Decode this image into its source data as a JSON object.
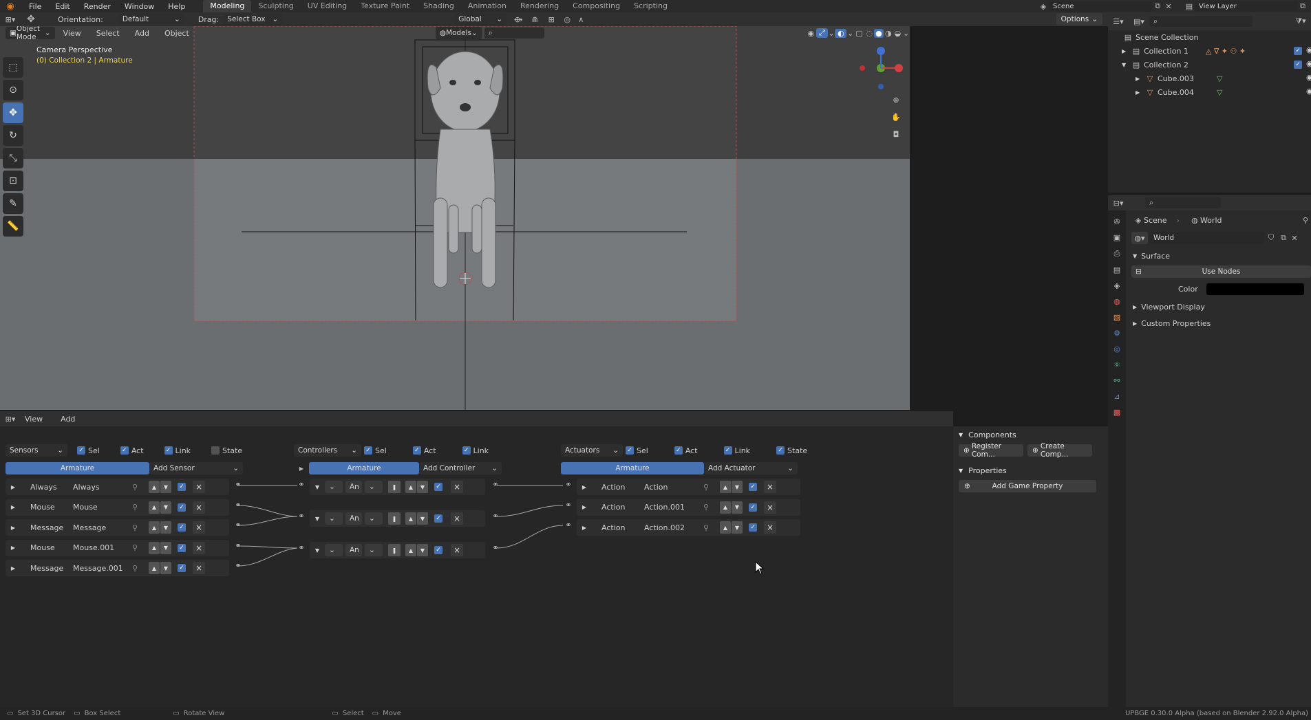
{
  "topbar": {
    "menu": [
      "File",
      "Edit",
      "Render",
      "Window",
      "Help"
    ],
    "workspaces": [
      "Modeling",
      "Sculpting",
      "UV Editing",
      "Texture Paint",
      "Shading",
      "Animation",
      "Rendering",
      "Compositing",
      "Scripting"
    ],
    "active_workspace": "Modeling",
    "scene": "Scene",
    "view_layer": "View Layer"
  },
  "tool_header": {
    "orientation_label": "Orientation:",
    "orientation_value": "Default",
    "drag_label": "Drag:",
    "drag_value": "Select Box",
    "transform_orientation": "Global",
    "options": "Options"
  },
  "viewport_header": {
    "mode": "Object Mode",
    "menus": [
      "View",
      "Select",
      "Add",
      "Object"
    ],
    "models": "Models"
  },
  "viewport": {
    "title": "Camera Perspective",
    "subtitle": "(0) Collection 2 | Armature"
  },
  "logic_editor": {
    "menus": [
      "View",
      "Add"
    ],
    "sensors": {
      "dropdown": "Sensors",
      "checks": [
        {
          "label": "Sel",
          "on": true
        },
        {
          "label": "Act",
          "on": true
        },
        {
          "label": "Link",
          "on": true
        },
        {
          "label": "State",
          "on": false
        }
      ],
      "object": "Armature",
      "add": "Add Sensor",
      "items": [
        {
          "type": "Always",
          "name": "Always"
        },
        {
          "type": "Mouse",
          "name": "Mouse"
        },
        {
          "type": "Message",
          "name": "Message"
        },
        {
          "type": "Mouse",
          "name": "Mouse.001"
        },
        {
          "type": "Message",
          "name": "Message.001"
        }
      ]
    },
    "controllers": {
      "dropdown": "Controllers",
      "checks": [
        {
          "label": "Sel",
          "on": true
        },
        {
          "label": "Act",
          "on": true
        },
        {
          "label": "Link",
          "on": true
        }
      ],
      "object": "Armature",
      "add": "Add Controller",
      "items": [
        {
          "type": "An"
        },
        {
          "type": "An"
        },
        {
          "type": "An"
        }
      ]
    },
    "actuators": {
      "dropdown": "Actuators",
      "checks": [
        {
          "label": "Sel",
          "on": true
        },
        {
          "label": "Act",
          "on": true
        },
        {
          "label": "Link",
          "on": true
        },
        {
          "label": "State",
          "on": true
        }
      ],
      "object": "Armature",
      "add": "Add Actuator",
      "items": [
        {
          "type": "Action",
          "name": "Action"
        },
        {
          "type": "Action",
          "name": "Action.001"
        },
        {
          "type": "Action",
          "name": "Action.002"
        }
      ]
    },
    "sidebar": {
      "components": "Components",
      "register": "Register Com...",
      "create": "Create Comp...",
      "properties": "Properties",
      "add_prop": "Add Game Property"
    }
  },
  "outliner": {
    "root": "Scene Collection",
    "items": [
      {
        "name": "Collection 1",
        "level": 1
      },
      {
        "name": "Collection 2",
        "level": 1
      },
      {
        "name": "Cube.003",
        "level": 2
      },
      {
        "name": "Cube.004",
        "level": 2
      }
    ]
  },
  "properties": {
    "breadcrumb_scene": "Scene",
    "breadcrumb_world": "World",
    "world_name": "World",
    "surface": "Surface",
    "use_nodes": "Use Nodes",
    "color_label": "Color",
    "viewport_display": "Viewport Display",
    "custom_properties": "Custom Properties"
  },
  "statusbar": {
    "items": [
      "Set 3D Cursor",
      "Box Select",
      "Rotate View",
      "Select",
      "Move"
    ],
    "version": "UPBGE 0.30.0 Alpha (based on Blender 2.92.0 Alpha)"
  },
  "colors": {
    "accent": "#4772b3",
    "viewport_bg": "#3d3d3d",
    "floor": "#6f7274"
  }
}
